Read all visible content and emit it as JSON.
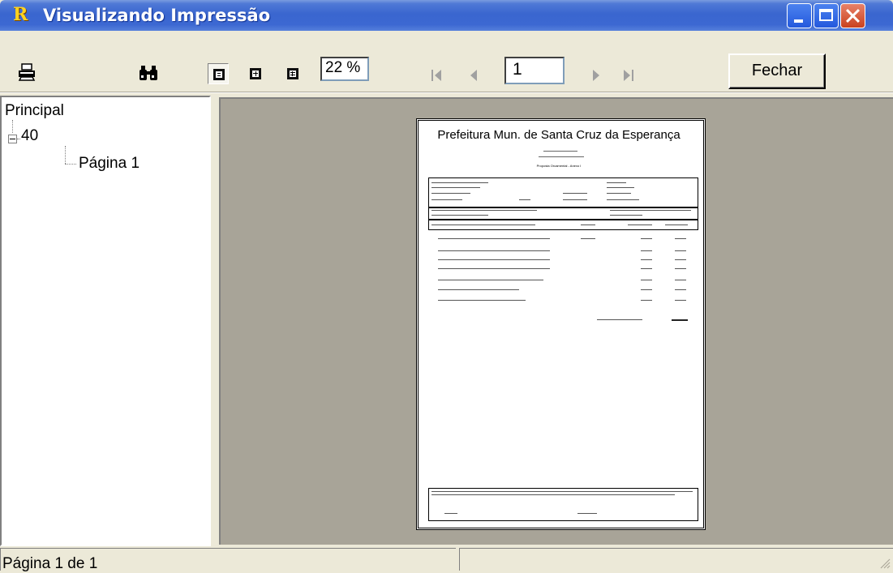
{
  "window": {
    "title": "Visualizando Impressão",
    "app_icon_letter": "R"
  },
  "toolbar": {
    "icons": [
      "printer-icon",
      "binoculars-icon",
      "single-page-view-icon",
      "two-page-view-icon",
      "multi-page-view-icon",
      "first-page-icon",
      "previous-page-icon",
      "next-page-icon",
      "last-page-icon"
    ],
    "zoom_value": "22 %",
    "page_value": "1",
    "close_label": "Fechar"
  },
  "tree": {
    "root": "Principal",
    "node": "40",
    "page": "Página 1"
  },
  "document": {
    "title": "Prefeitura Mun. de Santa Cruz da Esperança",
    "subtitle": "Proposta Orcamental - Anexo I"
  },
  "status": {
    "page_info": "Página 1 de 1"
  },
  "colors": {
    "titlebar": "#3a66cf",
    "preview_bg": "#a8a498",
    "window_bg": "#ece9d8"
  }
}
